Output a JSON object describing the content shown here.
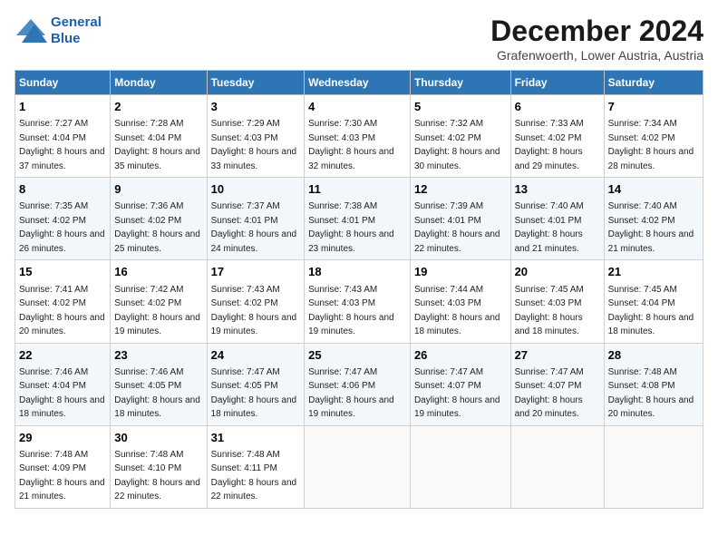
{
  "logo": {
    "line1": "General",
    "line2": "Blue"
  },
  "title": "December 2024",
  "subtitle": "Grafenwoerth, Lower Austria, Austria",
  "headers": [
    "Sunday",
    "Monday",
    "Tuesday",
    "Wednesday",
    "Thursday",
    "Friday",
    "Saturday"
  ],
  "weeks": [
    [
      {
        "day": "1",
        "sunrise": "Sunrise: 7:27 AM",
        "sunset": "Sunset: 4:04 PM",
        "daylight": "Daylight: 8 hours and 37 minutes."
      },
      {
        "day": "2",
        "sunrise": "Sunrise: 7:28 AM",
        "sunset": "Sunset: 4:04 PM",
        "daylight": "Daylight: 8 hours and 35 minutes."
      },
      {
        "day": "3",
        "sunrise": "Sunrise: 7:29 AM",
        "sunset": "Sunset: 4:03 PM",
        "daylight": "Daylight: 8 hours and 33 minutes."
      },
      {
        "day": "4",
        "sunrise": "Sunrise: 7:30 AM",
        "sunset": "Sunset: 4:03 PM",
        "daylight": "Daylight: 8 hours and 32 minutes."
      },
      {
        "day": "5",
        "sunrise": "Sunrise: 7:32 AM",
        "sunset": "Sunset: 4:02 PM",
        "daylight": "Daylight: 8 hours and 30 minutes."
      },
      {
        "day": "6",
        "sunrise": "Sunrise: 7:33 AM",
        "sunset": "Sunset: 4:02 PM",
        "daylight": "Daylight: 8 hours and 29 minutes."
      },
      {
        "day": "7",
        "sunrise": "Sunrise: 7:34 AM",
        "sunset": "Sunset: 4:02 PM",
        "daylight": "Daylight: 8 hours and 28 minutes."
      }
    ],
    [
      {
        "day": "8",
        "sunrise": "Sunrise: 7:35 AM",
        "sunset": "Sunset: 4:02 PM",
        "daylight": "Daylight: 8 hours and 26 minutes."
      },
      {
        "day": "9",
        "sunrise": "Sunrise: 7:36 AM",
        "sunset": "Sunset: 4:02 PM",
        "daylight": "Daylight: 8 hours and 25 minutes."
      },
      {
        "day": "10",
        "sunrise": "Sunrise: 7:37 AM",
        "sunset": "Sunset: 4:01 PM",
        "daylight": "Daylight: 8 hours and 24 minutes."
      },
      {
        "day": "11",
        "sunrise": "Sunrise: 7:38 AM",
        "sunset": "Sunset: 4:01 PM",
        "daylight": "Daylight: 8 hours and 23 minutes."
      },
      {
        "day": "12",
        "sunrise": "Sunrise: 7:39 AM",
        "sunset": "Sunset: 4:01 PM",
        "daylight": "Daylight: 8 hours and 22 minutes."
      },
      {
        "day": "13",
        "sunrise": "Sunrise: 7:40 AM",
        "sunset": "Sunset: 4:01 PM",
        "daylight": "Daylight: 8 hours and 21 minutes."
      },
      {
        "day": "14",
        "sunrise": "Sunrise: 7:40 AM",
        "sunset": "Sunset: 4:02 PM",
        "daylight": "Daylight: 8 hours and 21 minutes."
      }
    ],
    [
      {
        "day": "15",
        "sunrise": "Sunrise: 7:41 AM",
        "sunset": "Sunset: 4:02 PM",
        "daylight": "Daylight: 8 hours and 20 minutes."
      },
      {
        "day": "16",
        "sunrise": "Sunrise: 7:42 AM",
        "sunset": "Sunset: 4:02 PM",
        "daylight": "Daylight: 8 hours and 19 minutes."
      },
      {
        "day": "17",
        "sunrise": "Sunrise: 7:43 AM",
        "sunset": "Sunset: 4:02 PM",
        "daylight": "Daylight: 8 hours and 19 minutes."
      },
      {
        "day": "18",
        "sunrise": "Sunrise: 7:43 AM",
        "sunset": "Sunset: 4:03 PM",
        "daylight": "Daylight: 8 hours and 19 minutes."
      },
      {
        "day": "19",
        "sunrise": "Sunrise: 7:44 AM",
        "sunset": "Sunset: 4:03 PM",
        "daylight": "Daylight: 8 hours and 18 minutes."
      },
      {
        "day": "20",
        "sunrise": "Sunrise: 7:45 AM",
        "sunset": "Sunset: 4:03 PM",
        "daylight": "Daylight: 8 hours and 18 minutes."
      },
      {
        "day": "21",
        "sunrise": "Sunrise: 7:45 AM",
        "sunset": "Sunset: 4:04 PM",
        "daylight": "Daylight: 8 hours and 18 minutes."
      }
    ],
    [
      {
        "day": "22",
        "sunrise": "Sunrise: 7:46 AM",
        "sunset": "Sunset: 4:04 PM",
        "daylight": "Daylight: 8 hours and 18 minutes."
      },
      {
        "day": "23",
        "sunrise": "Sunrise: 7:46 AM",
        "sunset": "Sunset: 4:05 PM",
        "daylight": "Daylight: 8 hours and 18 minutes."
      },
      {
        "day": "24",
        "sunrise": "Sunrise: 7:47 AM",
        "sunset": "Sunset: 4:05 PM",
        "daylight": "Daylight: 8 hours and 18 minutes."
      },
      {
        "day": "25",
        "sunrise": "Sunrise: 7:47 AM",
        "sunset": "Sunset: 4:06 PM",
        "daylight": "Daylight: 8 hours and 19 minutes."
      },
      {
        "day": "26",
        "sunrise": "Sunrise: 7:47 AM",
        "sunset": "Sunset: 4:07 PM",
        "daylight": "Daylight: 8 hours and 19 minutes."
      },
      {
        "day": "27",
        "sunrise": "Sunrise: 7:47 AM",
        "sunset": "Sunset: 4:07 PM",
        "daylight": "Daylight: 8 hours and 20 minutes."
      },
      {
        "day": "28",
        "sunrise": "Sunrise: 7:48 AM",
        "sunset": "Sunset: 4:08 PM",
        "daylight": "Daylight: 8 hours and 20 minutes."
      }
    ],
    [
      {
        "day": "29",
        "sunrise": "Sunrise: 7:48 AM",
        "sunset": "Sunset: 4:09 PM",
        "daylight": "Daylight: 8 hours and 21 minutes."
      },
      {
        "day": "30",
        "sunrise": "Sunrise: 7:48 AM",
        "sunset": "Sunset: 4:10 PM",
        "daylight": "Daylight: 8 hours and 22 minutes."
      },
      {
        "day": "31",
        "sunrise": "Sunrise: 7:48 AM",
        "sunset": "Sunset: 4:11 PM",
        "daylight": "Daylight: 8 hours and 22 minutes."
      },
      null,
      null,
      null,
      null
    ]
  ]
}
